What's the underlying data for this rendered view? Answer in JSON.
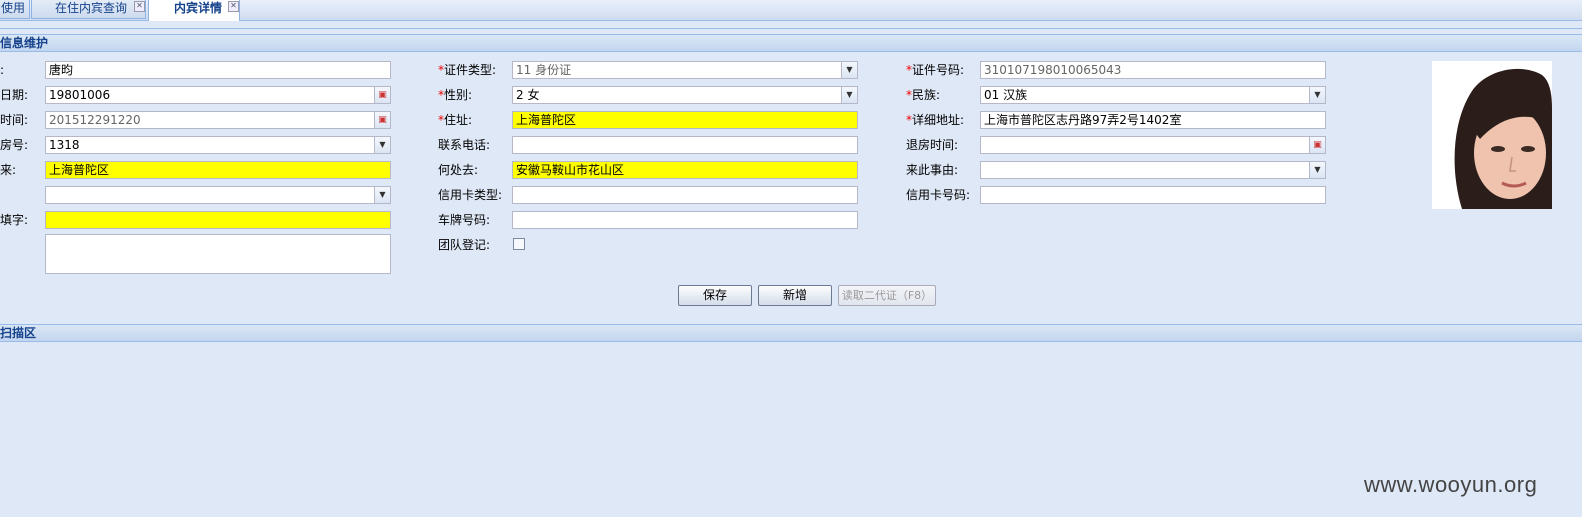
{
  "tabs": [
    {
      "label": "使用",
      "active": false
    },
    {
      "label": "在住内宾查询",
      "active": false
    },
    {
      "label": "内宾详情",
      "active": true
    }
  ],
  "panels": {
    "info_title": "信息维护",
    "scan_title": "扫描区"
  },
  "form": {
    "col1": {
      "row1_label": ":",
      "row1_value": "唐昀",
      "row2_label": "日期:",
      "row2_value": "19801006",
      "row3_label": "时间:",
      "row3_value": "201512291220",
      "row4_label": "房号:",
      "row4_value": "1318",
      "row5_label": "来:",
      "row5_value": "上海普陀区",
      "row6_value": "",
      "row7_label": "填字:",
      "row7_value": ""
    },
    "col2": {
      "id_type_label": "证件类型:",
      "id_type_value": "11  身份证",
      "gender_label": "性别:",
      "gender_value": "2  女",
      "address_label": "住址:",
      "address_value": "上海普陀区",
      "phone_label": "联系电话:",
      "phone_value": "",
      "destination_label": "何处去:",
      "destination_value": "安徽马鞍山市花山区",
      "card_type_label": "信用卡类型:",
      "card_type_value": "",
      "plate_label": "车牌号码:",
      "plate_value": "",
      "group_label": "团队登记:"
    },
    "col3": {
      "id_number_label": "证件号码:",
      "id_number_value": "310107198010065043",
      "ethnicity_label": "民族:",
      "ethnicity_value": "01  汉族",
      "detail_address_label": "详细地址:",
      "detail_address_value": "上海市普陀区志丹路97弄2号1402室",
      "checkout_label": "退房时间:",
      "checkout_value": "",
      "reason_label": "来此事由:",
      "reason_value": "",
      "card_number_label": "信用卡号码:",
      "card_number_value": ""
    },
    "required_mark": "*"
  },
  "buttons": {
    "save": "保存",
    "add": "新增",
    "read_id": "读取二代证（F8）"
  },
  "watermark": "www.wooyun.org",
  "colors": {
    "highlight": "#ffff00",
    "header_text": "#15428b",
    "required": "#ee0000"
  }
}
